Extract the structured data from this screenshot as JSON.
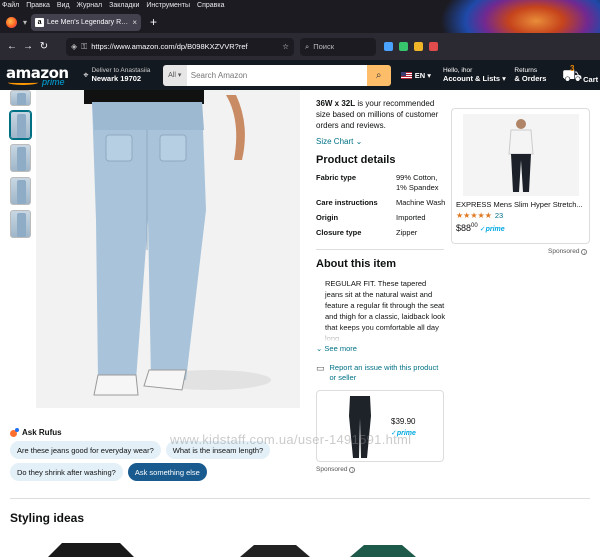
{
  "menubar": [
    "Файл",
    "Правка",
    "Вид",
    "Журнал",
    "Закладки",
    "Инструменты",
    "Справка"
  ],
  "browser": {
    "tab_title": "Lee Men's Legendary Regular Fit",
    "tab_favicon": "a",
    "url": "https://www.amazon.com/dp/B098KXZVVR?ref",
    "search_placeholder": "Поиск"
  },
  "header": {
    "logo_word": "amazon",
    "logo_prime": "prime",
    "deliver_line1": "Deliver to Anastasiia",
    "deliver_line2": "Newark 19702",
    "search_category": "All",
    "search_placeholder": "Search Amazon",
    "language": "EN",
    "account_line1": "Hello, ihor",
    "account_line2": "Account & Lists",
    "returns_line1": "Returns",
    "returns_line2": "& Orders",
    "cart_count": "3",
    "cart_label": "Cart"
  },
  "product": {
    "size_rec_bold": "36W x 32L",
    "size_rec_rest": " is your recommended size based on millions of customer orders and reviews.",
    "size_chart": "Size Chart",
    "details_title": "Product details",
    "details": [
      {
        "key": "Fabric type",
        "value": "99% Cotton, 1% Spandex"
      },
      {
        "key": "Care instructions",
        "value": "Machine Wash"
      },
      {
        "key": "Origin",
        "value": "Imported"
      },
      {
        "key": "Closure type",
        "value": "Zipper"
      }
    ],
    "about_title": "About this item",
    "about_text": "REGULAR FIT. These tapered jeans sit at the natural waist and feature a regular fit through the seat and thigh for a classic, laidback look that keeps you comfortable all day long.",
    "see_more": "See more",
    "report": "Report an issue with this product or seller"
  },
  "center_ad": {
    "price": "$39.90",
    "prime": "✓prime",
    "sponsored": "Sponsored"
  },
  "right_ad": {
    "title": "EXPRESS Mens Slim Hyper Stretch...",
    "stars": "★★★★★",
    "rating_count": "23",
    "price_whole": "$88",
    "price_fraction": "00",
    "prime": "✓prime",
    "sponsored": "Sponsored"
  },
  "rufus": {
    "title": "Ask Rufus",
    "chips": [
      "Are these jeans good for everyday wear?",
      "What is the inseam length?",
      "Do they shrink after washing?"
    ],
    "ask_button": "Ask something else"
  },
  "styling_title": "Styling ideas",
  "watermark": "www.kidstaff.com.ua/user-1491591.html",
  "colors": {
    "amazon_dark": "#131921",
    "amazon_orange": "#ff9900",
    "link": "#007185",
    "chip": "#e4f0f8",
    "chip_dark": "#1a5b8f"
  }
}
